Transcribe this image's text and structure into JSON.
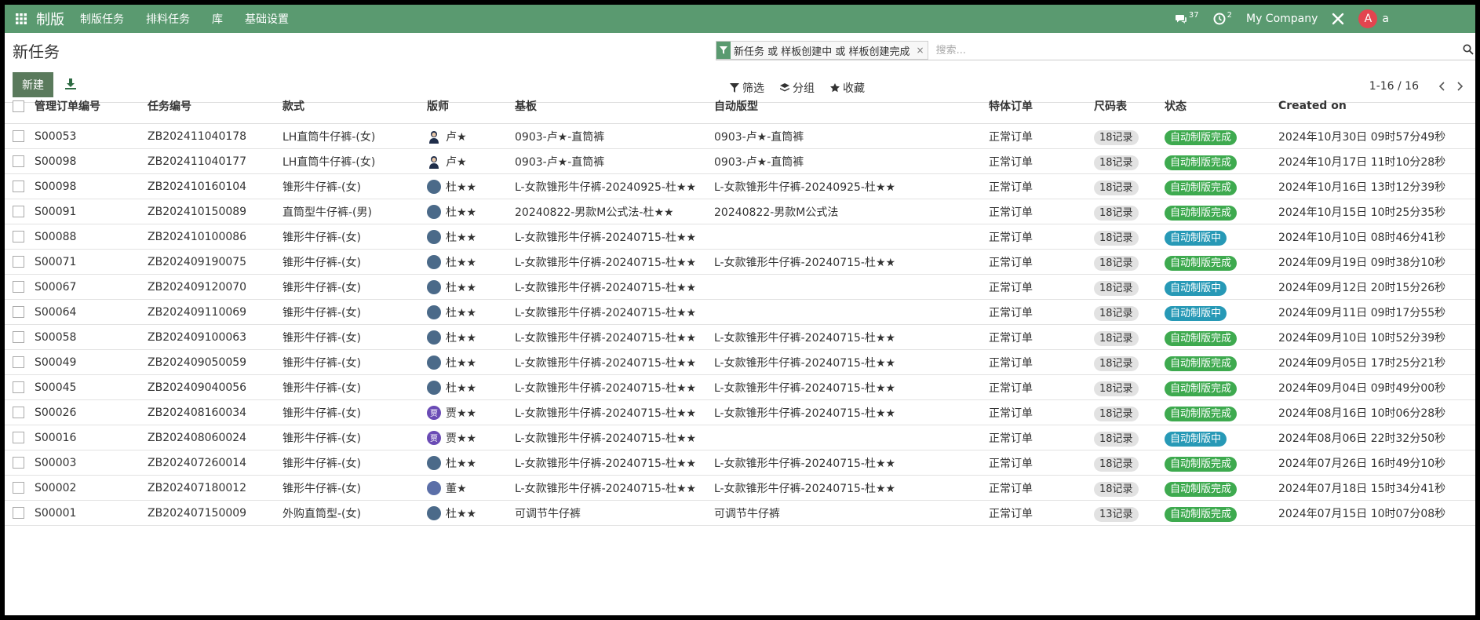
{
  "app": {
    "title": "制版",
    "menu": [
      "制版任务",
      "排料任务",
      "库",
      "基础设置"
    ],
    "messages_count": "37",
    "activities_count": "2",
    "company": "My Company",
    "user_initial": "A",
    "user_name": "a"
  },
  "control": {
    "page_title": "新任务",
    "new_button": "新建",
    "facet_text": "新任务 或 样板创建中 或 样板创建完成",
    "search_placeholder": "搜索...",
    "filters": [
      "筛选",
      "分组",
      "收藏"
    ],
    "pager": "1-16 / 16"
  },
  "table": {
    "columns": [
      "管理订单编号",
      "任务编号",
      "款式",
      "版师",
      "基板",
      "自动版型",
      "特体订单",
      "尺码表",
      "状态",
      "Created on"
    ],
    "rows": [
      {
        "order": "S00053",
        "task": "ZB202411040178",
        "style": "LH直筒牛仔裤-(女)",
        "designer": "卢★",
        "avatar": "lu",
        "base": "0903-卢★-直筒裤",
        "auto": "0903-卢★-直筒裤",
        "special": "正常订单",
        "size": "18记录",
        "status": "自动制版完成",
        "created": "2024年10月30日 09时57分49秒"
      },
      {
        "order": "S00098",
        "task": "ZB202411040177",
        "style": "LH直筒牛仔裤-(女)",
        "designer": "卢★",
        "avatar": "lu",
        "base": "0903-卢★-直筒裤",
        "auto": "0903-卢★-直筒裤",
        "special": "正常订单",
        "size": "18记录",
        "status": "自动制版完成",
        "created": "2024年10月17日 11时10分28秒"
      },
      {
        "order": "S00098",
        "task": "ZB202410160104",
        "style": "锥形牛仔裤-(女)",
        "designer": "杜★★",
        "avatar": "du",
        "base": "L-女款锥形牛仔裤-20240925-杜★★",
        "auto": "L-女款锥形牛仔裤-20240925-杜★★",
        "special": "正常订单",
        "size": "18记录",
        "status": "自动制版完成",
        "created": "2024年10月16日 13时12分39秒"
      },
      {
        "order": "S00091",
        "task": "ZB202410150089",
        "style": "直筒型牛仔裤-(男)",
        "designer": "杜★★",
        "avatar": "du",
        "base": "20240822-男款M公式法-杜★★",
        "auto": "20240822-男款M公式法",
        "special": "正常订单",
        "size": "18记录",
        "status": "自动制版完成",
        "created": "2024年10月15日 10时25分35秒"
      },
      {
        "order": "S00088",
        "task": "ZB202410100086",
        "style": "锥形牛仔裤-(女)",
        "designer": "杜★★",
        "avatar": "du",
        "base": "L-女款锥形牛仔裤-20240715-杜★★",
        "auto": "",
        "special": "正常订单",
        "size": "18记录",
        "status": "自动制版中",
        "created": "2024年10月10日 08时46分41秒"
      },
      {
        "order": "S00071",
        "task": "ZB202409190075",
        "style": "锥形牛仔裤-(女)",
        "designer": "杜★★",
        "avatar": "du",
        "base": "L-女款锥形牛仔裤-20240715-杜★★",
        "auto": "L-女款锥形牛仔裤-20240715-杜★★",
        "special": "正常订单",
        "size": "18记录",
        "status": "自动制版完成",
        "created": "2024年09月19日 09时38分10秒"
      },
      {
        "order": "S00067",
        "task": "ZB202409120070",
        "style": "锥形牛仔裤-(女)",
        "designer": "杜★★",
        "avatar": "du",
        "base": "L-女款锥形牛仔裤-20240715-杜★★",
        "auto": "",
        "special": "正常订单",
        "size": "18记录",
        "status": "自动制版中",
        "created": "2024年09月12日 20时15分26秒"
      },
      {
        "order": "S00064",
        "task": "ZB202409110069",
        "style": "锥形牛仔裤-(女)",
        "designer": "杜★★",
        "avatar": "du",
        "base": "L-女款锥形牛仔裤-20240715-杜★★",
        "auto": "",
        "special": "正常订单",
        "size": "18记录",
        "status": "自动制版中",
        "created": "2024年09月11日 09时17分55秒"
      },
      {
        "order": "S00058",
        "task": "ZB202409100063",
        "style": "锥形牛仔裤-(女)",
        "designer": "杜★★",
        "avatar": "du",
        "base": "L-女款锥形牛仔裤-20240715-杜★★",
        "auto": "L-女款锥形牛仔裤-20240715-杜★★",
        "special": "正常订单",
        "size": "18记录",
        "status": "自动制版完成",
        "created": "2024年09月10日 10时52分39秒"
      },
      {
        "order": "S00049",
        "task": "ZB202409050059",
        "style": "锥形牛仔裤-(女)",
        "designer": "杜★★",
        "avatar": "du",
        "base": "L-女款锥形牛仔裤-20240715-杜★★",
        "auto": "L-女款锥形牛仔裤-20240715-杜★★",
        "special": "正常订单",
        "size": "18记录",
        "status": "自动制版完成",
        "created": "2024年09月05日 17时25分21秒"
      },
      {
        "order": "S00045",
        "task": "ZB202409040056",
        "style": "锥形牛仔裤-(女)",
        "designer": "杜★★",
        "avatar": "du",
        "base": "L-女款锥形牛仔裤-20240715-杜★★",
        "auto": "L-女款锥形牛仔裤-20240715-杜★★",
        "special": "正常订单",
        "size": "18记录",
        "status": "自动制版完成",
        "created": "2024年09月04日 09时49分00秒"
      },
      {
        "order": "S00026",
        "task": "ZB202408160034",
        "style": "锥形牛仔裤-(女)",
        "designer": "贾★★",
        "avatar": "jia",
        "base": "L-女款锥形牛仔裤-20240715-杜★★",
        "auto": "L-女款锥形牛仔裤-20240715-杜★★",
        "special": "正常订单",
        "size": "18记录",
        "status": "自动制版完成",
        "created": "2024年08月16日 10时06分28秒"
      },
      {
        "order": "S00016",
        "task": "ZB202408060024",
        "style": "锥形牛仔裤-(女)",
        "designer": "贾★★",
        "avatar": "jia",
        "base": "L-女款锥形牛仔裤-20240715-杜★★",
        "auto": "",
        "special": "正常订单",
        "size": "18记录",
        "status": "自动制版中",
        "created": "2024年08月06日 22时32分50秒"
      },
      {
        "order": "S00003",
        "task": "ZB202407260014",
        "style": "锥形牛仔裤-(女)",
        "designer": "杜★★",
        "avatar": "du",
        "base": "L-女款锥形牛仔裤-20240715-杜★★",
        "auto": "L-女款锥形牛仔裤-20240715-杜★★",
        "special": "正常订单",
        "size": "18记录",
        "status": "自动制版完成",
        "created": "2024年07月26日 16时49分10秒"
      },
      {
        "order": "S00002",
        "task": "ZB202407180012",
        "style": "锥形牛仔裤-(女)",
        "designer": "董★",
        "avatar": "dong",
        "base": "L-女款锥形牛仔裤-20240715-杜★★",
        "auto": "L-女款锥形牛仔裤-20240715-杜★★",
        "special": "正常订单",
        "size": "18记录",
        "status": "自动制版完成",
        "created": "2024年07月18日 15时34分41秒"
      },
      {
        "order": "S00001",
        "task": "ZB202407150009",
        "style": "外购直筒型-(女)",
        "designer": "杜★★",
        "avatar": "du",
        "base": "可调节牛仔裤",
        "auto": "可调节牛仔裤",
        "special": "正常订单",
        "size": "13记录",
        "status": "自动制版完成",
        "created": "2024年07月15日 10时07分08秒"
      }
    ]
  },
  "colors": {
    "brand": "#5a9a70",
    "status_done": "#3eaa4f",
    "status_running": "#2799b6"
  }
}
